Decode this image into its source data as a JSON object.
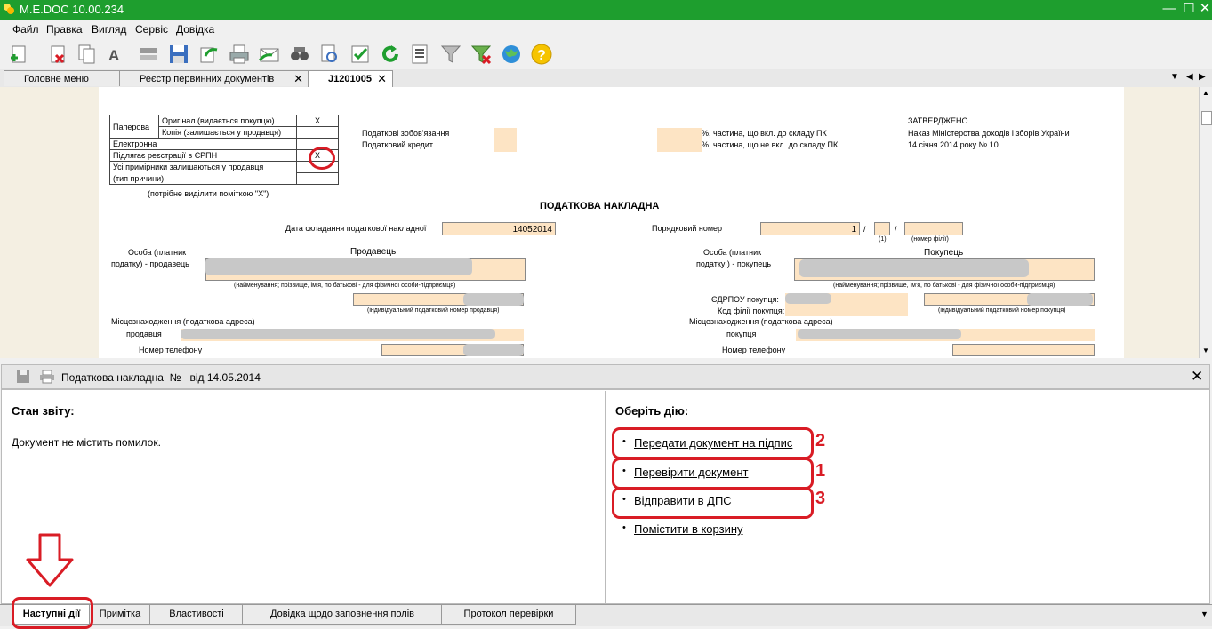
{
  "window": {
    "title": "M.E.DOC 10.00.234"
  },
  "menu": [
    "Файл",
    "Правка",
    "Вигляд",
    "Сервіс",
    "Довідка"
  ],
  "tabs": [
    {
      "label": "Головне меню"
    },
    {
      "label": "Реєстр первинних документів"
    },
    {
      "label": "J1201005"
    }
  ],
  "form": {
    "paper_table": {
      "paper": "Паперова",
      "original": "Оригінал (видається покупцю)",
      "original_mark": "Х",
      "copy": "Копія (залишається у продавця)",
      "electronic": "Електронна",
      "registration": "Підлягає реєстрації в ЄРПН",
      "registration_mark": "Х",
      "copies_left": "Усі примірники залишаються у продавця",
      "reason_type": "(тип причини)",
      "note": "(потрібне виділити поміткою \"Х\")"
    },
    "tax_liabilities": "Податкові зобов'язання",
    "tax_credit": "Податковий кредит",
    "pk_included": "%, частина, що вкл. до складу ПК",
    "pk_not_included": "%, частина, що не вкл. до складу ПК",
    "approved": "ЗАТВЕРДЖЕНО",
    "order_line1": "Наказ Міністерства доходів і зборів України",
    "order_line2": "14 січня 2014 року  № 10",
    "heading": "ПОДАТКОВА НАКЛАДНА",
    "date_label": "Дата складання податкової накладної",
    "date_value": "14052014",
    "serial_label": "Порядковий номер",
    "serial_value": "1",
    "slash": "/",
    "marker_1": "(1)",
    "branch_number": "(номер філії)",
    "seller_person_l1": "Особа (платник",
    "seller_person_l2": "податку) - продавець",
    "seller": "Продавець",
    "buyer_person_l1": "Особа (платник",
    "buyer_person_l2": "податку ) - покупець",
    "buyer": "Покупець",
    "name_hint": "(найменування; прізвище, ім'я, по батькові - для фізичної особи-підприємця)",
    "seller_itn": "(індивідуальний податковий номер продавця)",
    "buyer_itn": "(індивідуальний податковий номер покупця)",
    "edrpou": "ЄДРПОУ покупця:",
    "branch_code": "Код філії покупця:",
    "location": "Місцезнаходження (податкова адреса)",
    "seller_word": "продавця",
    "buyer_word": "покупця",
    "phone": "Номер телефону"
  },
  "panel": {
    "title": "Податкова накладна  №   від 14.05.2014",
    "status_heading": "Стан звіту:",
    "status_text": "Документ не містить помилок.",
    "actions_heading": "Оберіть дію:",
    "actions": [
      {
        "label": "Передати документ на підпис",
        "step": "2"
      },
      {
        "label": "Перевірити документ",
        "step": "1"
      },
      {
        "label": "Відправити в ДПС",
        "step": "3"
      },
      {
        "label": "Помістити в корзину",
        "step": ""
      }
    ]
  },
  "bottom_tabs": [
    "Наступні дії",
    "Примітка",
    "Властивості",
    "Довідка щодо заповнення полів",
    "Протокол перевірки"
  ],
  "colors": {
    "titlebar": "#1e9e2e",
    "form_fill": "#fde4c4",
    "annotation": "#d91c25"
  }
}
